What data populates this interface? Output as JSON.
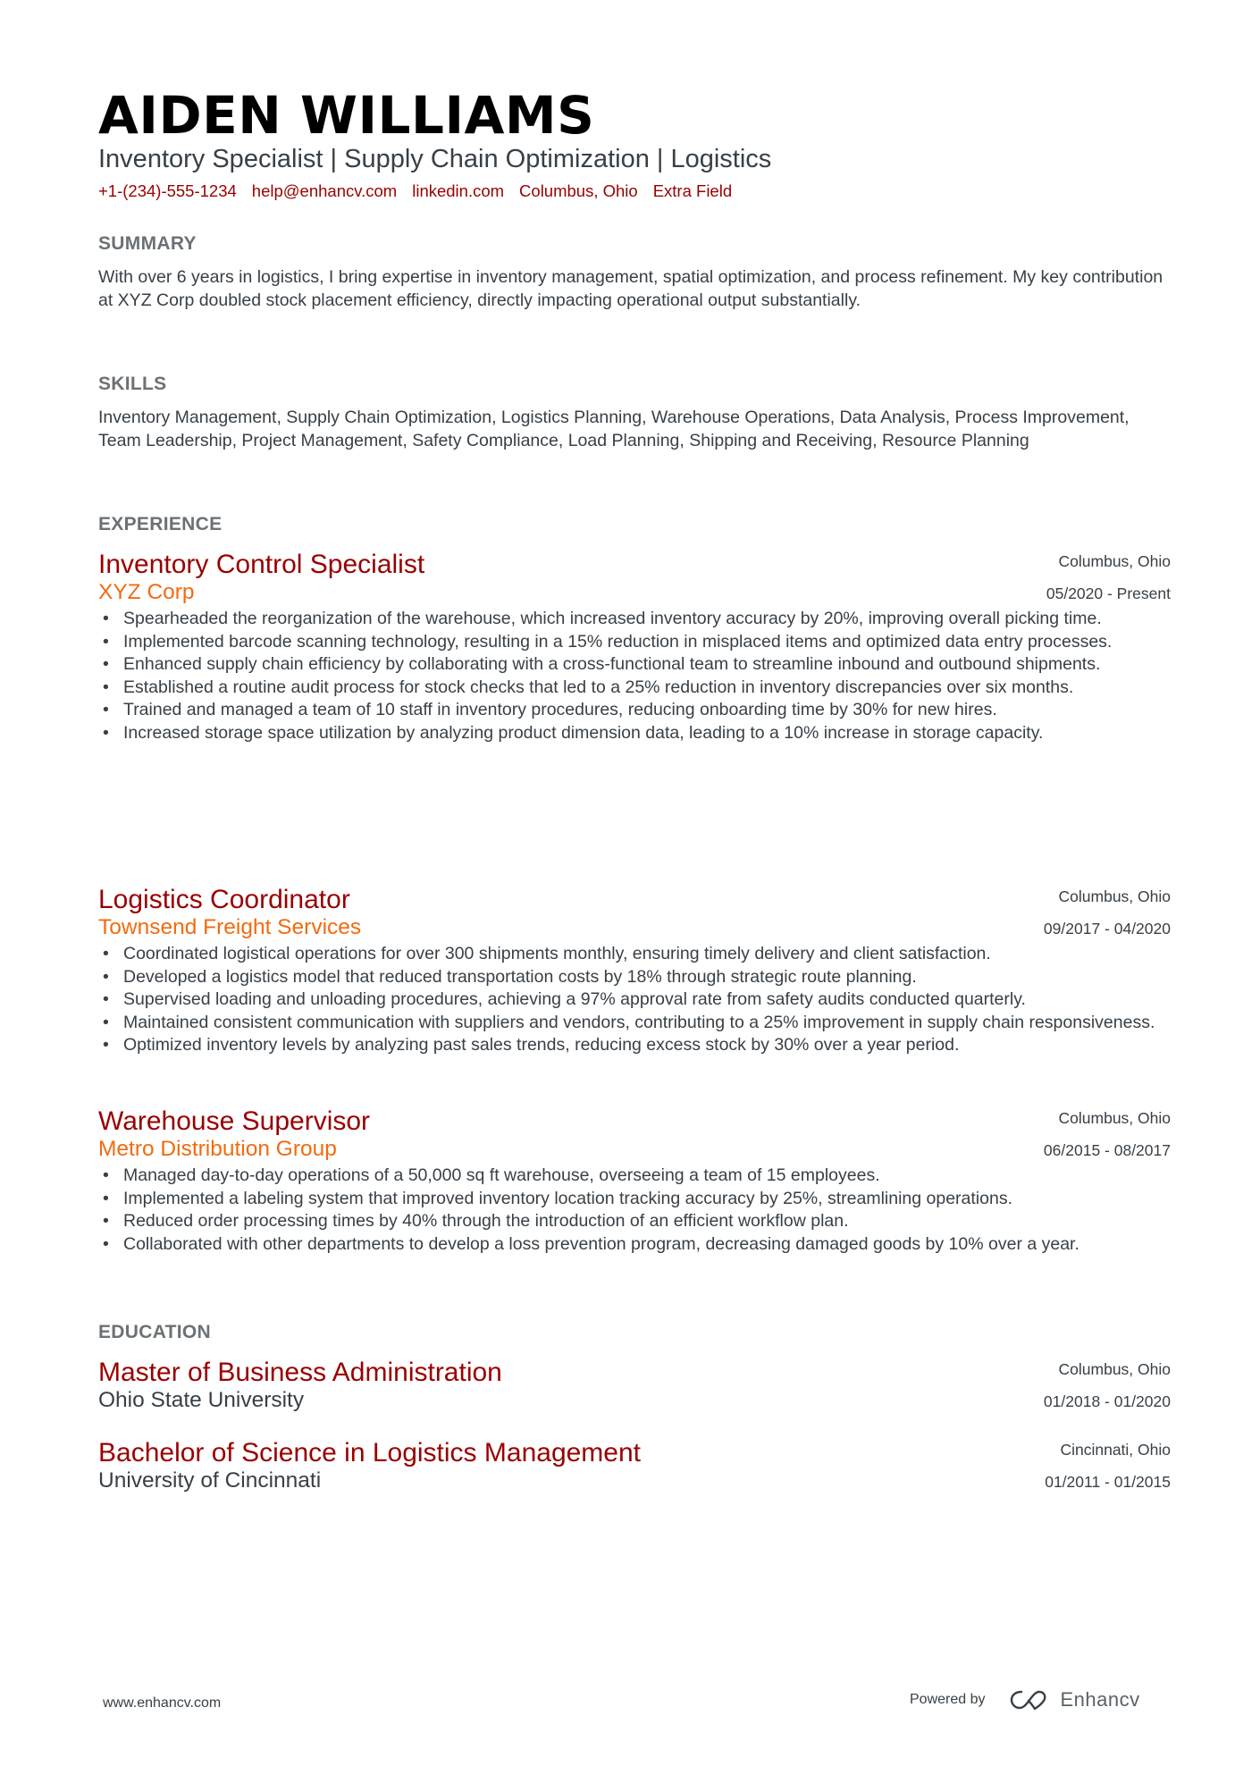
{
  "header": {
    "name": "AIDEN WILLIAMS",
    "subtitle": "Inventory Specialist | Supply Chain Optimization | Logistics",
    "contacts": [
      "+1-(234)-555-1234",
      "help@enhancv.com",
      "linkedin.com",
      "Columbus, Ohio",
      "Extra Field"
    ]
  },
  "summary": {
    "heading": "SUMMARY",
    "text": "With over 6 years in logistics, I bring expertise in inventory management, spatial optimization, and process refinement. My key contribution at XYZ Corp doubled stock placement efficiency, directly impacting operational output substantially."
  },
  "skills": {
    "heading": "SKILLS",
    "text": "Inventory Management, Supply Chain Optimization, Logistics Planning, Warehouse Operations, Data Analysis, Process Improvement, Team Leadership, Project Management, Safety Compliance, Load Planning, Shipping and Receiving, Resource Planning"
  },
  "experience": {
    "heading": "EXPERIENCE",
    "jobs": [
      {
        "title": "Inventory Control Specialist",
        "company": "XYZ Corp",
        "location": "Columbus, Ohio",
        "dates": "05/2020 - Present",
        "bullets": [
          "Spearheaded the reorganization of the warehouse, which increased inventory accuracy by 20%, improving overall picking time.",
          "Implemented barcode scanning technology, resulting in a 15% reduction in misplaced items and optimized data entry processes.",
          "Enhanced supply chain efficiency by collaborating with a cross-functional team to streamline inbound and outbound shipments.",
          "Established a routine audit process for stock checks that led to a 25% reduction in inventory discrepancies over six months.",
          "Trained and managed a team of 10 staff in inventory procedures, reducing onboarding time by 30% for new hires.",
          "Increased storage space utilization by analyzing product dimension data, leading to a 10% increase in storage capacity."
        ]
      },
      {
        "title": "Logistics Coordinator",
        "company": "Townsend Freight Services",
        "location": "Columbus, Ohio",
        "dates": "09/2017 - 04/2020",
        "bullets": [
          "Coordinated logistical operations for over 300 shipments monthly, ensuring timely delivery and client satisfaction.",
          "Developed a logistics model that reduced transportation costs by 18% through strategic route planning.",
          "Supervised loading and unloading procedures, achieving a 97% approval rate from safety audits conducted quarterly.",
          "Maintained consistent communication with suppliers and vendors, contributing to a 25% improvement in supply chain responsiveness.",
          "Optimized inventory levels by analyzing past sales trends, reducing excess stock by 30% over a year period."
        ]
      },
      {
        "title": "Warehouse Supervisor",
        "company": "Metro Distribution Group",
        "location": "Columbus, Ohio",
        "dates": "06/2015 - 08/2017",
        "bullets": [
          "Managed day-to-day operations of a 50,000 sq ft warehouse, overseeing a team of 15 employees.",
          "Implemented a labeling system that improved inventory location tracking accuracy by 25%, streamlining operations.",
          "Reduced order processing times by 40% through the introduction of an efficient workflow plan.",
          "Collaborated with other departments to develop a loss prevention program, decreasing damaged goods by 10% over a year."
        ]
      }
    ]
  },
  "education": {
    "heading": "EDUCATION",
    "entries": [
      {
        "degree": "Master of Business Administration",
        "school": "Ohio State University",
        "location": "Columbus, Ohio",
        "dates": "01/2018 - 01/2020"
      },
      {
        "degree": "Bachelor of Science in Logistics Management",
        "school": "University of Cincinnati",
        "location": "Cincinnati, Ohio",
        "dates": "01/2011 - 01/2015"
      }
    ]
  },
  "footer": {
    "website": "www.enhancv.com",
    "powered_by": "Powered by",
    "brand": "Enhancv",
    "brand_icon": "enhancv-logo-icon"
  }
}
